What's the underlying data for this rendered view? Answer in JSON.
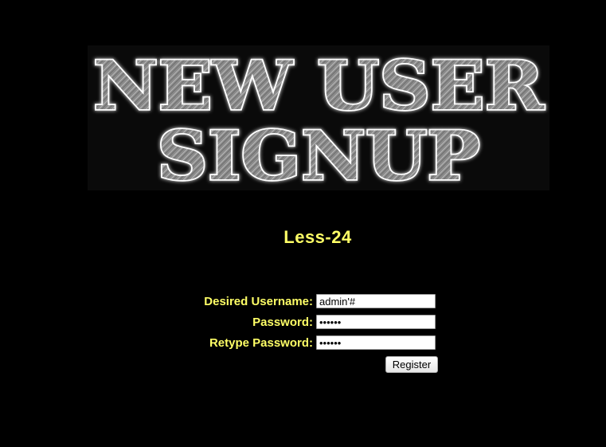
{
  "banner": {
    "line1": "NEW USER",
    "line2": "SIGNUP"
  },
  "heading": {
    "lesson": "Less-24"
  },
  "form": {
    "username_label": "Desired Username:",
    "username_value": "admin'#",
    "password_label": "Password:",
    "password_value": "••••••",
    "retype_label": "Retype Password:",
    "retype_value": "••••••",
    "register_label": "Register"
  },
  "colors": {
    "background": "#000000",
    "text_accent": "#ffff66",
    "banner_text": "#9a9a9a"
  }
}
